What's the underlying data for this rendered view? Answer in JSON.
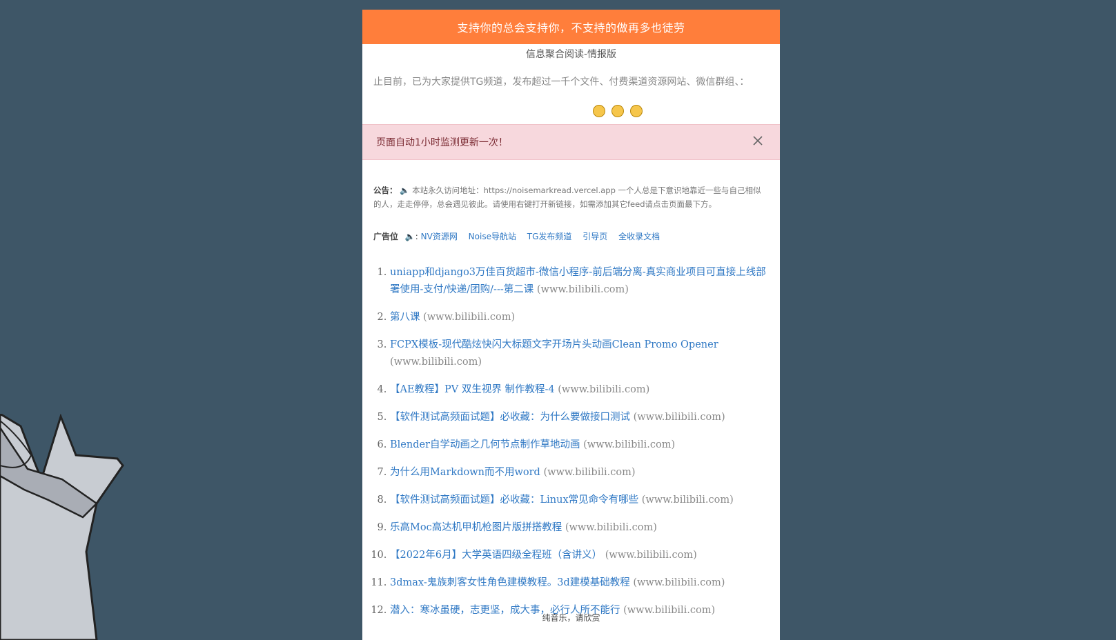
{
  "banner": {
    "text": "支持你的总会支持你，不支持的做再多也徒劳"
  },
  "subtitle": "信息聚合阅读-情报版",
  "marquee": "止目前，已为大家提供TG频道，发布超过一千个文件、付费渠道资源网站、微信群组、：",
  "alert": {
    "text": "页面自动1小时监测更新一次！"
  },
  "notice": {
    "label": "公告：",
    "text": "本站永久访问地址：https://noisemarkread.vercel.app 一个人总是下意识地靠近一些与自己相似的人，走走停停，总会遇见彼此。请使用右键打开新链接，如需添加其它feed请点击页面最下方。"
  },
  "ads": {
    "label": "广告位",
    "links": [
      "NV资源网",
      "Noise导航站",
      "TG发布频道",
      "引导页",
      "全收录文档"
    ]
  },
  "items": [
    {
      "title": "uniapp和django3万佳百货超市-微信小程序-前后端分离-真实商业项目可直接上线部署使用-支付/快递/团购/---第二课",
      "source": "(www.bilibili.com)"
    },
    {
      "title": "第八课",
      "source": "(www.bilibili.com)"
    },
    {
      "title": "FCPX模板-现代酷炫快闪大标题文字开场片头动画Clean Promo Opener",
      "source": "(www.bilibili.com)"
    },
    {
      "title": "【AE教程】PV 双生视界 制作教程-4",
      "source": "(www.bilibili.com)"
    },
    {
      "title": "【软件测试高频面试题】必收藏：为什么要做接口测试",
      "source": "(www.bilibili.com)"
    },
    {
      "title": "Blender自学动画之几何节点制作草地动画",
      "source": "(www.bilibili.com)"
    },
    {
      "title": "为什么用Markdown而不用word",
      "source": "(www.bilibili.com)"
    },
    {
      "title": "【软件测试高频面试题】必收藏：Linux常见命令有哪些",
      "source": "(www.bilibili.com)"
    },
    {
      "title": "乐高Moc高达机甲机枪图片版拼搭教程",
      "source": "(www.bilibili.com)"
    },
    {
      "title": "【2022年6月】大学英语四级全程班（含讲义）",
      "source": "(www.bilibili.com)"
    },
    {
      "title": "3dmax-鬼族刺客女性角色建模教程。3d建模基础教程",
      "source": "(www.bilibili.com)"
    },
    {
      "title": "潜入：寒冰虽硬，志更坚，成大事，必行人所不能行",
      "source": "(www.bilibili.com)"
    }
  ],
  "footer": "纯音乐，请欣赏"
}
